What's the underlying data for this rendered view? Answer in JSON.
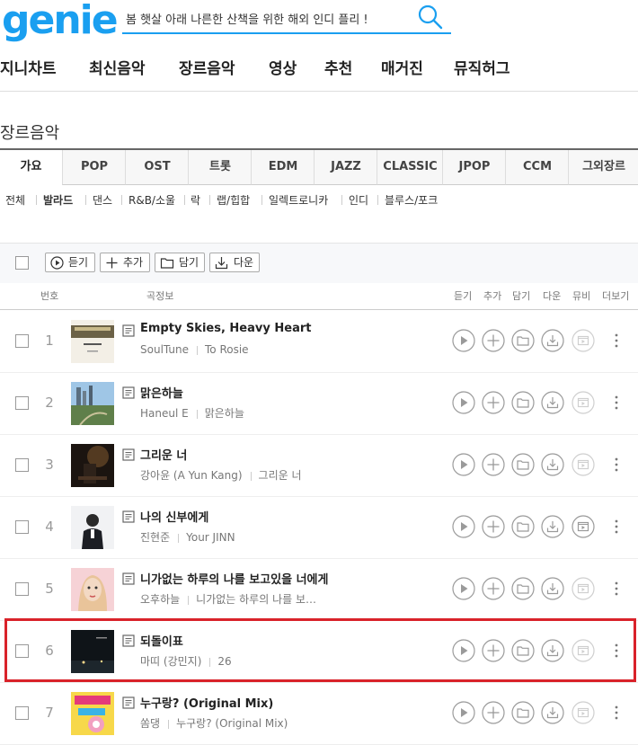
{
  "logo": "genie",
  "search": {
    "value": "봄 햇살 아래 나른한 산책을 위한 해외 인디 플리 !",
    "placeholder": ""
  },
  "gnb": [
    "지니차트",
    "최신음악",
    "장르음악",
    "영상",
    "추천",
    "매거진",
    "뮤직허그"
  ],
  "section_title": "장르음악",
  "genre_tabs": [
    "가요",
    "POP",
    "OST",
    "트롯",
    "EDM",
    "JAZZ",
    "CLASSIC",
    "JPOP",
    "CCM",
    "그외장르"
  ],
  "subgenres": [
    "전체",
    "발라드",
    "댄스",
    "R&B/소울",
    "락",
    "랩/힙합",
    "일렉트로니카",
    "인디",
    "블루스/포크"
  ],
  "toolbar": {
    "listen": "듣기",
    "add": "추가",
    "save": "담기",
    "download": "다운"
  },
  "table_header": {
    "number": "번호",
    "song_info": "곡정보",
    "listen": "듣기",
    "add": "추가",
    "save": "담기",
    "download": "다운",
    "mv": "뮤비",
    "more": "더보기"
  },
  "songs": [
    {
      "rank": "1",
      "title": "Empty Skies, Heavy Heart",
      "artist": "SoulTune",
      "album": "To Rosie",
      "has_mv": false
    },
    {
      "rank": "2",
      "title": "맑은하늘",
      "artist": "Haneul E",
      "album": "맑은하늘",
      "has_mv": false
    },
    {
      "rank": "3",
      "title": "그리운 너",
      "artist": "강아윤 (A Yun Kang)",
      "album": "그리운 너",
      "has_mv": false
    },
    {
      "rank": "4",
      "title": "나의 신부에게",
      "artist": "진현준",
      "album": "Your JINN",
      "has_mv": true
    },
    {
      "rank": "5",
      "title": "니가없는 하루의 나를 보고있을 너에게",
      "artist": "오후하늘",
      "album": "니가없는 하루의 나를 보…",
      "has_mv": false
    },
    {
      "rank": "6",
      "title": "되돌이표",
      "artist": "마띠 (강민지)",
      "album": "26",
      "has_mv": false
    },
    {
      "rank": "7",
      "title": "누구랑? (Original Mix)",
      "artist": "쏨댕",
      "album": "누구랑? (Original Mix)",
      "has_mv": false
    }
  ],
  "album_art_text": {
    "1_line1": "To Rosie"
  },
  "colors": {
    "brand": "#1a9ff0",
    "highlight": "#d9222a"
  }
}
